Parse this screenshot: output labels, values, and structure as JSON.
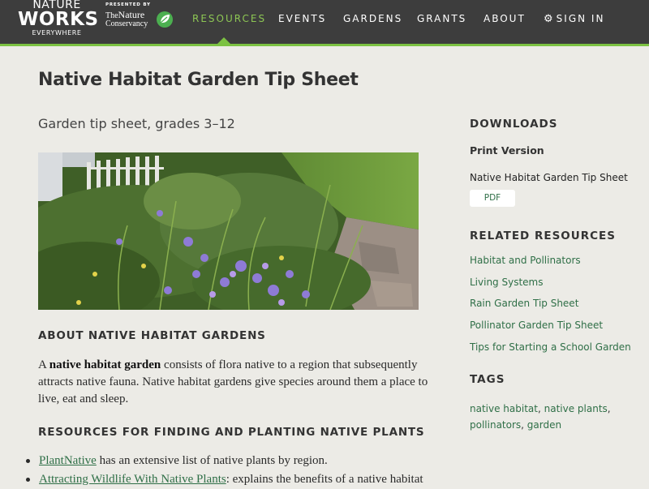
{
  "header": {
    "logo": {
      "line1": "NATURE",
      "line2": "WORKS",
      "line3": "EVERYWHERE"
    },
    "presented_by": "PRESENTED BY",
    "partner": {
      "line1": "The",
      "line2": "Nature",
      "line3": "Conservancy"
    },
    "nav": [
      {
        "label": "RESOURCES",
        "active": true
      },
      {
        "label": "EVENTS",
        "active": false
      },
      {
        "label": "GARDENS",
        "active": false
      },
      {
        "label": "GRANTS",
        "active": false
      },
      {
        "label": "ABOUT",
        "active": false
      },
      {
        "label": "SIGN IN",
        "active": false,
        "icon": "gear-icon"
      }
    ],
    "accent_color": "#7cc242",
    "active_color": "#8dc654",
    "background_color": "#3d3d3d"
  },
  "main": {
    "title": "Native Habitat Garden Tip Sheet",
    "subtitle": "Garden tip sheet, grades 3–12",
    "about_heading": "ABOUT NATIVE HABITAT GARDENS",
    "about_text": {
      "prefix": "A ",
      "bold": "native habitat garden",
      "rest": " consists of flora native to a region that subsequently attracts native fauna. Native habitat gardens give species around them a place to live, eat and sleep."
    },
    "resources_heading": "RESOURCES FOR FINDING AND PLANTING NATIVE PLANTS",
    "resources": [
      {
        "link": "PlantNative",
        "text": " has an extensive list of native plants by region."
      },
      {
        "link": "Attracting Wildlife With Native Plants",
        "text": ": explains the benefits of a native habitat"
      }
    ]
  },
  "sidebar": {
    "downloads_heading": "DOWNLOADS",
    "print_version": "Print Version",
    "file_name": "Native Habitat Garden Tip Sheet",
    "pdf_label": "PDF",
    "related_heading": "RELATED RESOURCES",
    "related": [
      "Habitat and Pollinators",
      "Living Systems",
      "Rain Garden Tip Sheet",
      "Pollinator Garden Tip Sheet",
      "Tips for Starting a School Garden"
    ],
    "tags_heading": "TAGS",
    "tags": [
      "native habitat",
      "native plants",
      "pollinators",
      "garden"
    ],
    "link_color": "#2f6f47"
  }
}
